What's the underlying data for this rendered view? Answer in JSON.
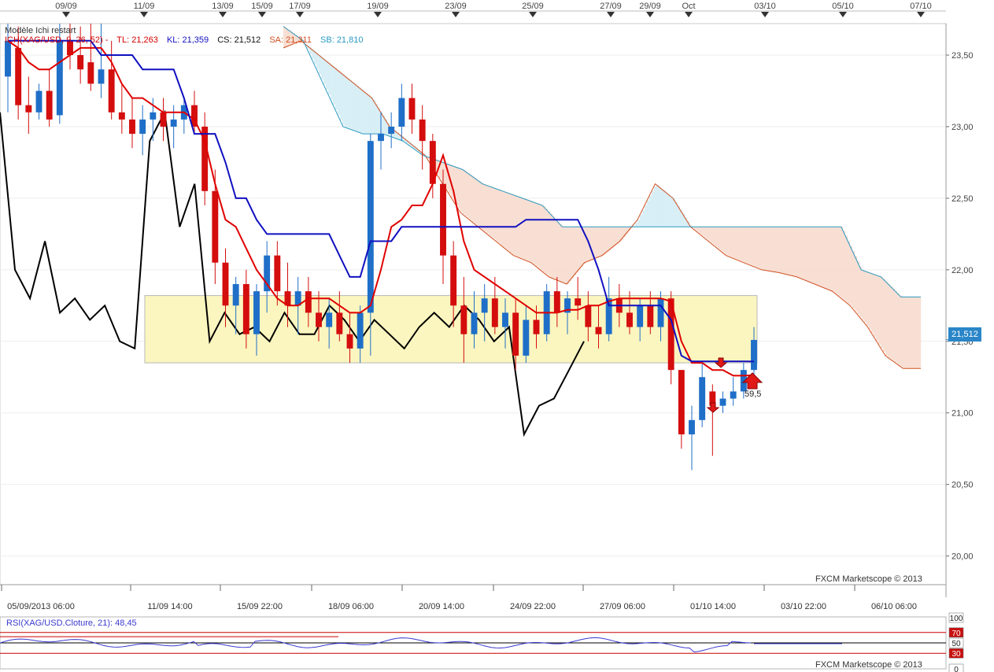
{
  "top_dates": [
    "09/09",
    "11/09",
    "13/09",
    "15/09",
    "17/09",
    "19/09",
    "23/09",
    "25/09",
    "27/09",
    "29/09",
    "Oct",
    "03/10",
    "05/10",
    "07/10"
  ],
  "bottom_dates": [
    "05/09/2013 06:00",
    "11/09 14:00",
    "15/09 22:00",
    "18/09 06:00",
    "20/09 14:00",
    "24/09 22:00",
    "27/09 06:00",
    "01/10 14:00",
    "03/10 22:00",
    "06/10 06:00"
  ],
  "legend": {
    "title": "Modèle Ichi restart",
    "series_text": "ICH(XAG/USD, 9, 26, 52) -",
    "tl": "TL: 21,263",
    "kl": "KL: 21,359",
    "cs": "CS: 21,512",
    "sa": "SA: 21,311",
    "sb": "SB: 21,810"
  },
  "price_tag": "21,512",
  "callout": "59,5",
  "credit": "FXCM Marketscope © 2013",
  "rsi": {
    "title": "RSI(XAG/USD.Cloture, 21): 48,45",
    "levels": [
      "100",
      "70",
      "50",
      "30",
      "0"
    ]
  },
  "colors": {
    "bull": "#1f6fc8",
    "bear": "#d40d0d",
    "tenkan": "#e00000",
    "kijun": "#1010c0",
    "chikou": "#000000",
    "cloud_fill": "#f7d9cc",
    "cloud_bull_fill": "#d2ecf5",
    "senkou_a": "#d05020",
    "senkou_b": "#2a9ac0",
    "highlight_box": "#fbf6bf"
  },
  "chart_data": {
    "type": "candlestick",
    "title": "",
    "ylim": [
      19.8,
      23.72
    ],
    "y_ticks": [
      20.0,
      20.5,
      21.0,
      21.5,
      22.0,
      22.5,
      23.0,
      23.5
    ],
    "y_tick_labels": [
      "20,00",
      "20,50",
      "21,00",
      "21,50",
      "22,00",
      "22,50",
      "23,00",
      "23,50"
    ],
    "last_price": 21.512,
    "highlight_range": [
      21.35,
      21.82
    ],
    "candles": [
      {
        "o": 23.35,
        "h": 23.75,
        "l": 23.1,
        "c": 23.6
      },
      {
        "o": 23.55,
        "h": 23.7,
        "l": 23.05,
        "c": 23.15
      },
      {
        "o": 23.15,
        "h": 23.35,
        "l": 22.95,
        "c": 23.1
      },
      {
        "o": 23.1,
        "h": 23.3,
        "l": 23.05,
        "c": 23.25
      },
      {
        "o": 23.25,
        "h": 23.4,
        "l": 23.0,
        "c": 23.05
      },
      {
        "o": 23.08,
        "h": 23.72,
        "l": 23.02,
        "c": 23.6
      },
      {
        "o": 23.6,
        "h": 23.72,
        "l": 23.4,
        "c": 23.5
      },
      {
        "o": 23.5,
        "h": 23.7,
        "l": 23.3,
        "c": 23.4
      },
      {
        "o": 23.45,
        "h": 23.72,
        "l": 23.25,
        "c": 23.3
      },
      {
        "o": 23.3,
        "h": 23.72,
        "l": 23.2,
        "c": 23.4
      },
      {
        "o": 23.4,
        "h": 23.6,
        "l": 23.05,
        "c": 23.1
      },
      {
        "o": 23.1,
        "h": 23.3,
        "l": 22.95,
        "c": 23.05
      },
      {
        "o": 23.05,
        "h": 23.2,
        "l": 22.85,
        "c": 22.95
      },
      {
        "o": 22.95,
        "h": 23.15,
        "l": 22.8,
        "c": 23.05
      },
      {
        "o": 23.05,
        "h": 23.2,
        "l": 22.9,
        "c": 23.1
      },
      {
        "o": 23.1,
        "h": 23.2,
        "l": 22.9,
        "c": 23.0
      },
      {
        "o": 23.0,
        "h": 23.15,
        "l": 22.85,
        "c": 23.05
      },
      {
        "o": 23.05,
        "h": 23.2,
        "l": 22.95,
        "c": 23.15
      },
      {
        "o": 23.15,
        "h": 23.25,
        "l": 22.95,
        "c": 23.0
      },
      {
        "o": 23.0,
        "h": 23.1,
        "l": 22.45,
        "c": 22.55
      },
      {
        "o": 22.55,
        "h": 22.7,
        "l": 21.9,
        "c": 22.05
      },
      {
        "o": 22.05,
        "h": 22.15,
        "l": 21.6,
        "c": 21.75
      },
      {
        "o": 21.75,
        "h": 21.95,
        "l": 21.55,
        "c": 21.9
      },
      {
        "o": 21.9,
        "h": 22.0,
        "l": 21.45,
        "c": 21.55
      },
      {
        "o": 21.55,
        "h": 21.9,
        "l": 21.4,
        "c": 21.85
      },
      {
        "o": 21.85,
        "h": 22.2,
        "l": 21.7,
        "c": 22.1
      },
      {
        "o": 22.1,
        "h": 22.2,
        "l": 21.75,
        "c": 21.85
      },
      {
        "o": 21.85,
        "h": 22.05,
        "l": 21.6,
        "c": 21.75
      },
      {
        "o": 21.75,
        "h": 21.95,
        "l": 21.55,
        "c": 21.85
      },
      {
        "o": 21.85,
        "h": 21.95,
        "l": 21.6,
        "c": 21.7
      },
      {
        "o": 21.7,
        "h": 21.85,
        "l": 21.5,
        "c": 21.6
      },
      {
        "o": 21.6,
        "h": 21.8,
        "l": 21.45,
        "c": 21.7
      },
      {
        "o": 21.7,
        "h": 21.85,
        "l": 21.5,
        "c": 21.55
      },
      {
        "o": 21.55,
        "h": 21.7,
        "l": 21.35,
        "c": 21.45
      },
      {
        "o": 21.45,
        "h": 21.75,
        "l": 21.35,
        "c": 21.7
      },
      {
        "o": 21.7,
        "h": 22.95,
        "l": 21.4,
        "c": 22.9
      },
      {
        "o": 22.9,
        "h": 23.1,
        "l": 22.7,
        "c": 22.95
      },
      {
        "o": 22.95,
        "h": 23.1,
        "l": 22.85,
        "c": 23.0
      },
      {
        "o": 23.0,
        "h": 23.3,
        "l": 22.9,
        "c": 23.2
      },
      {
        "o": 23.2,
        "h": 23.3,
        "l": 22.95,
        "c": 23.05
      },
      {
        "o": 23.05,
        "h": 23.15,
        "l": 22.7,
        "c": 22.9
      },
      {
        "o": 22.9,
        "h": 22.95,
        "l": 22.5,
        "c": 22.6
      },
      {
        "o": 22.6,
        "h": 22.7,
        "l": 21.9,
        "c": 22.1
      },
      {
        "o": 22.1,
        "h": 22.2,
        "l": 21.6,
        "c": 21.75
      },
      {
        "o": 21.75,
        "h": 21.95,
        "l": 21.35,
        "c": 21.55
      },
      {
        "o": 21.55,
        "h": 21.85,
        "l": 21.45,
        "c": 21.7
      },
      {
        "o": 21.7,
        "h": 21.9,
        "l": 21.5,
        "c": 21.8
      },
      {
        "o": 21.8,
        "h": 21.95,
        "l": 21.55,
        "c": 21.6
      },
      {
        "o": 21.6,
        "h": 21.8,
        "l": 21.45,
        "c": 21.7
      },
      {
        "o": 21.7,
        "h": 21.8,
        "l": 21.3,
        "c": 21.4
      },
      {
        "o": 21.4,
        "h": 21.75,
        "l": 21.35,
        "c": 21.65
      },
      {
        "o": 21.65,
        "h": 21.75,
        "l": 21.45,
        "c": 21.55
      },
      {
        "o": 21.55,
        "h": 21.9,
        "l": 21.5,
        "c": 21.85
      },
      {
        "o": 21.85,
        "h": 21.95,
        "l": 21.6,
        "c": 21.7
      },
      {
        "o": 21.7,
        "h": 21.85,
        "l": 21.55,
        "c": 21.8
      },
      {
        "o": 21.8,
        "h": 21.95,
        "l": 21.65,
        "c": 21.75
      },
      {
        "o": 21.75,
        "h": 21.85,
        "l": 21.5,
        "c": 21.6
      },
      {
        "o": 21.6,
        "h": 21.75,
        "l": 21.45,
        "c": 21.55
      },
      {
        "o": 21.55,
        "h": 21.95,
        "l": 21.5,
        "c": 21.8
      },
      {
        "o": 21.8,
        "h": 21.9,
        "l": 21.6,
        "c": 21.7
      },
      {
        "o": 21.7,
        "h": 21.85,
        "l": 21.55,
        "c": 21.6
      },
      {
        "o": 21.6,
        "h": 21.8,
        "l": 21.5,
        "c": 21.75
      },
      {
        "o": 21.75,
        "h": 21.85,
        "l": 21.55,
        "c": 21.6
      },
      {
        "o": 21.6,
        "h": 21.85,
        "l": 21.5,
        "c": 21.8
      },
      {
        "o": 21.8,
        "h": 21.85,
        "l": 21.2,
        "c": 21.3
      },
      {
        "o": 21.3,
        "h": 21.15,
        "l": 20.75,
        "c": 20.85
      },
      {
        "o": 20.85,
        "h": 21.05,
        "l": 20.6,
        "c": 20.95
      },
      {
        "o": 20.95,
        "h": 21.35,
        "l": 20.9,
        "c": 21.25
      },
      {
        "o": 21.15,
        "h": 21.2,
        "l": 20.7,
        "c": 21.05
      },
      {
        "o": 21.05,
        "h": 21.15,
        "l": 21.0,
        "c": 21.1
      },
      {
        "o": 21.1,
        "h": 21.25,
        "l": 21.05,
        "c": 21.15
      },
      {
        "o": 21.15,
        "h": 21.35,
        "l": 21.1,
        "c": 21.3
      },
      {
        "o": 21.3,
        "h": 21.6,
        "l": 21.25,
        "c": 21.51
      }
    ],
    "tenkan": [
      23.6,
      23.55,
      23.45,
      23.4,
      23.4,
      23.45,
      23.5,
      23.55,
      23.55,
      23.55,
      23.45,
      23.3,
      23.2,
      23.2,
      23.15,
      23.1,
      23.1,
      23.1,
      23.05,
      22.9,
      22.6,
      22.35,
      22.3,
      22.15,
      22.0,
      21.9,
      21.8,
      21.75,
      21.75,
      21.8,
      21.8,
      21.8,
      21.75,
      21.7,
      21.7,
      21.75,
      22.0,
      22.3,
      22.35,
      22.45,
      22.45,
      22.6,
      22.8,
      22.55,
      22.2,
      22.0,
      21.95,
      21.9,
      21.85,
      21.8,
      21.75,
      21.7,
      21.7,
      21.7,
      21.72,
      21.72,
      21.75,
      21.75,
      21.78,
      21.8,
      21.8,
      21.8,
      21.8,
      21.8,
      21.78,
      21.5,
      21.35,
      21.35,
      21.3,
      21.3,
      21.26,
      21.26,
      21.263
    ],
    "kijun": [
      23.6,
      23.6,
      23.6,
      23.6,
      23.6,
      23.6,
      23.6,
      23.6,
      23.6,
      23.5,
      23.5,
      23.5,
      23.5,
      23.4,
      23.4,
      23.4,
      23.4,
      23.2,
      22.95,
      22.95,
      22.95,
      22.75,
      22.5,
      22.5,
      22.35,
      22.25,
      22.25,
      22.25,
      22.25,
      22.25,
      22.25,
      22.25,
      22.1,
      21.95,
      21.95,
      22.2,
      22.2,
      22.2,
      22.3,
      22.3,
      22.3,
      22.3,
      22.3,
      22.3,
      22.3,
      22.3,
      22.3,
      22.3,
      22.3,
      22.3,
      22.35,
      22.35,
      22.35,
      22.35,
      22.35,
      22.35,
      22.2,
      22.0,
      21.75,
      21.75,
      21.75,
      21.75,
      21.75,
      21.75,
      21.65,
      21.4,
      21.36,
      21.36,
      21.36,
      21.36,
      21.36,
      21.36,
      21.359
    ],
    "chikou": [
      23.1,
      22.0,
      21.8,
      22.2,
      21.7,
      21.8,
      21.65,
      21.75,
      21.5,
      21.45,
      22.9,
      23.1,
      22.3,
      22.6,
      21.5,
      21.7,
      21.55,
      21.6,
      21.5,
      21.7,
      21.55,
      21.55,
      21.75,
      21.65,
      21.5,
      21.65,
      21.55,
      21.45,
      21.6,
      21.7,
      21.6,
      21.75,
      21.65,
      21.5,
      21.6,
      20.85,
      21.05,
      21.1,
      21.3,
      21.5
    ],
    "senkou_a": [
      23.55,
      23.6,
      23.5,
      23.4,
      23.3,
      23.2,
      23.0,
      22.9,
      22.8,
      22.6,
      22.4,
      22.3,
      22.2,
      22.1,
      22.05,
      21.95,
      21.9,
      22.05,
      22.1,
      22.2,
      22.35,
      22.6,
      22.5,
      22.3,
      22.2,
      22.1,
      22.05,
      22.0,
      21.98,
      21.95,
      21.9,
      21.85,
      21.75,
      21.6,
      21.4,
      21.31,
      21.311
    ],
    "senkou_b": [
      23.7,
      23.6,
      23.3,
      23.0,
      22.95,
      22.95,
      22.9,
      22.8,
      22.75,
      22.7,
      22.6,
      22.55,
      22.5,
      22.45,
      22.3,
      22.3,
      22.3,
      22.3,
      22.3,
      22.3,
      22.3,
      22.3,
      22.3,
      22.3,
      22.3,
      22.3,
      22.3,
      22.3,
      22.3,
      22.0,
      21.95,
      21.81,
      21.81
    ],
    "rsi_value": 48.45,
    "rsi_levels": [
      100,
      70,
      50,
      30,
      0
    ]
  }
}
